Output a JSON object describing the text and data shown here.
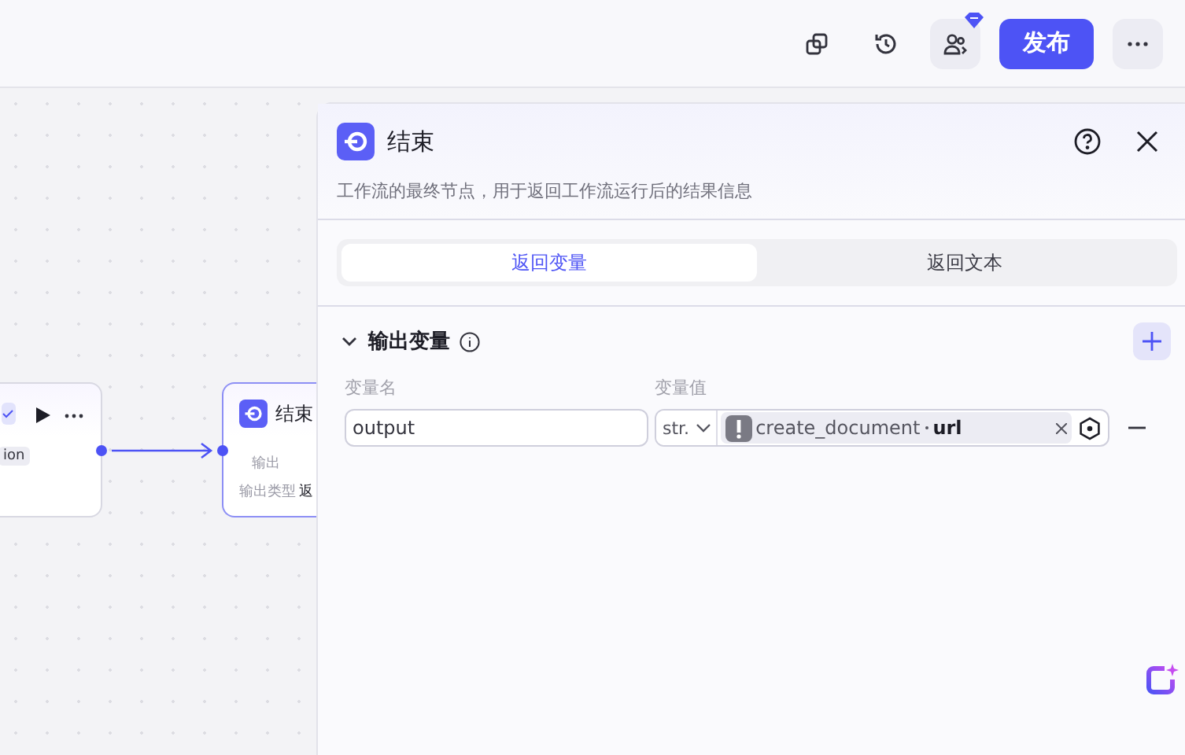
{
  "toolbar": {
    "publish": "发布",
    "notification": true
  },
  "canvas": {
    "prev_node": {
      "tag": "ion"
    },
    "end_node": {
      "title": "结束",
      "rows": [
        {
          "label": "输出",
          "value": ""
        },
        {
          "label": "输出类型",
          "value": "返"
        }
      ]
    }
  },
  "panel": {
    "title": "结束",
    "description": "工作流的最终节点，用于返回工作流运行后的结果信息",
    "tabs": [
      {
        "label": "返回变量",
        "selected": true
      },
      {
        "label": "返回文本",
        "selected": false
      }
    ],
    "section": {
      "title": "输出变量",
      "expanded": true,
      "columns": [
        "变量名",
        "变量值"
      ],
      "rows": [
        {
          "name": "output",
          "type": "str.",
          "ref_node": "create_document",
          "ref_field": "url"
        }
      ]
    }
  }
}
